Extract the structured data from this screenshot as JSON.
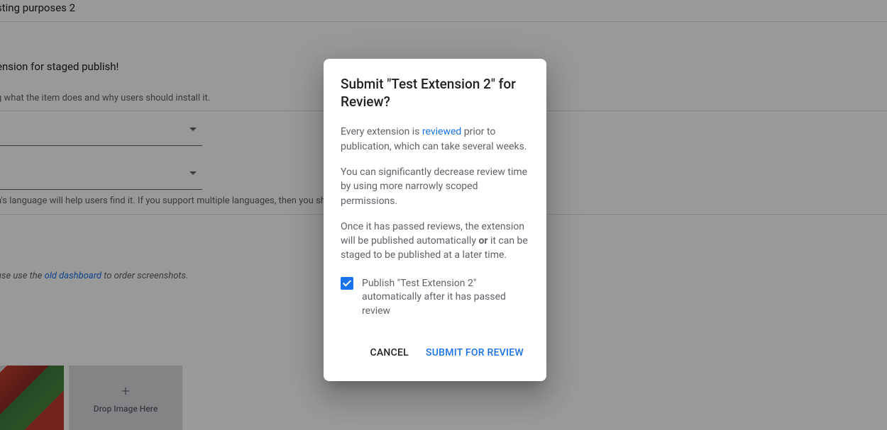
{
  "background": {
    "row1": "sting purposes 2",
    "row2": "ension for staged publish!",
    "row3": "g what the item does and why users should install it.",
    "row4": "n's language will help users find it. If you support multiple languages, then you sh",
    "row5_pre": "use use the ",
    "row5_link": "old dashboard",
    "row5_post": " to order screenshots.",
    "dropzone_label": "Drop Image Here"
  },
  "dialog": {
    "title": "Submit \"Test Extension 2\" for Review?",
    "para1_pre": "Every extension is ",
    "para1_link": "reviewed",
    "para1_post": " prior to publication, which can take several weeks.",
    "para2": "You can significantly decrease review time by using more narrowly scoped permissions.",
    "para3_pre": "Once it has passed reviews, the extension will be published automatically ",
    "para3_strong": "or",
    "para3_post": " it can be staged to be published at a later time.",
    "checkbox_label": "Publish \"Test Extension 2\" automatically after it has passed review",
    "checkbox_checked": true,
    "cancel_label": "CANCEL",
    "submit_label": "SUBMIT FOR REVIEW"
  }
}
